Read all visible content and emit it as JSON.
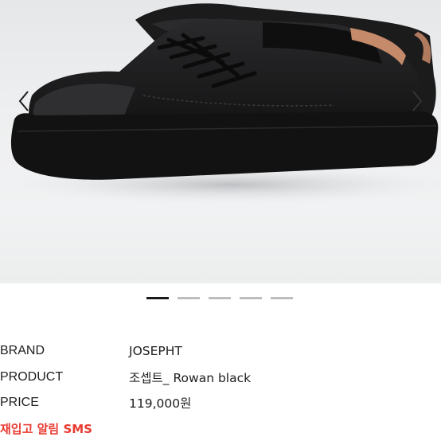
{
  "gallery": {
    "image_alt": "black low-top leather sneakers",
    "prev_icon": "chevron-left-icon",
    "next_icon": "chevron-right-icon",
    "slide_count": 5,
    "active_slide": 1
  },
  "info": {
    "rows": [
      {
        "label": "BRAND",
        "value": "JOSEPHT"
      },
      {
        "label": "PRODUCT",
        "value": "조셉트_ Rowan black"
      },
      {
        "label": "PRICE",
        "value": "119,000원"
      }
    ]
  },
  "restock": {
    "label": "재입고 알림 SMS",
    "color": "#e83a2f"
  }
}
